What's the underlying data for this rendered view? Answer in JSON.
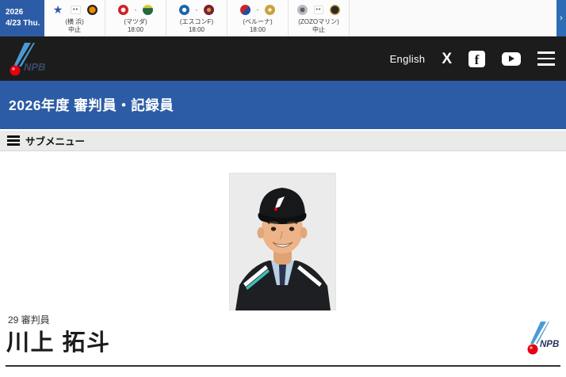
{
  "colors": {
    "primary_blue": "#2d5ca6",
    "ticker_arrow_blue": "#2e6db6",
    "header_black": "#1c1c1c",
    "submenu_gray": "#eaeae8",
    "npb_red": "#e60012",
    "npb_light_blue": "#4a9ad4"
  },
  "ticker": {
    "date_line1": "2026",
    "date_line2": "4/23 Thu.",
    "more_arrow": "›",
    "games": [
      {
        "venue": "(横 浜)",
        "status": "中止",
        "separator": "••",
        "home": {
          "name": "baystars",
          "glyph": "★",
          "color": "#2a58a6"
        },
        "away": {
          "name": "giants",
          "bg": "radial-gradient(circle, #f18a00 42%, #26221e 48%)"
        }
      },
      {
        "venue": "(マツダ)",
        "status": "18:00",
        "separator": "-",
        "home": {
          "name": "carp",
          "bg": "radial-gradient(circle, #ffffff 28%, #d02027 34%)"
        },
        "away": {
          "name": "swallows",
          "bg": "linear-gradient(180deg, #e3c431 30%, #1e6b3c 34%)"
        }
      },
      {
        "venue": "(エスコンF)",
        "status": "18:00",
        "separator": "-",
        "home": {
          "name": "fighters",
          "bg": "radial-gradient(circle, #ffffff 26%, #1b63ad 32%)"
        },
        "away": {
          "name": "eagles",
          "bg": "radial-gradient(circle, #c6a253 24%, #7c1f2d 32%)"
        }
      },
      {
        "venue": "(ベルーナ)",
        "status": "18:00",
        "separator": "-",
        "home": {
          "name": "lions",
          "bg": "linear-gradient(135deg, #c8252c 50%, #1f4fa0 50%)"
        },
        "away": {
          "name": "buffaloes",
          "bg": "radial-gradient(circle, #fff6da 18%, #c9a23f 28%)"
        }
      },
      {
        "venue": "(ZOZOマリン)",
        "status": "中止",
        "separator": "••",
        "home": {
          "name": "marines",
          "bg": "radial-gradient(circle, #5a5f66 28%, #b9bdc2 36%)"
        },
        "away": {
          "name": "hawks",
          "bg": "radial-gradient(circle, #2a2a2a 52%, #c9a23f 58%, #c9a23f 74%, #2a2a2a 80%)"
        }
      }
    ]
  },
  "header": {
    "english_label": "English",
    "x_label": "X",
    "fb_label": "f",
    "icons": [
      "x-icon",
      "facebook-icon",
      "youtube-icon",
      "menu-icon"
    ]
  },
  "title_bar": {
    "title": "2026年度 審判員・記録員"
  },
  "submenu": {
    "label": "サブメニュー"
  },
  "profile": {
    "number_label": "29 審判員",
    "name": "川上 拓斗"
  }
}
